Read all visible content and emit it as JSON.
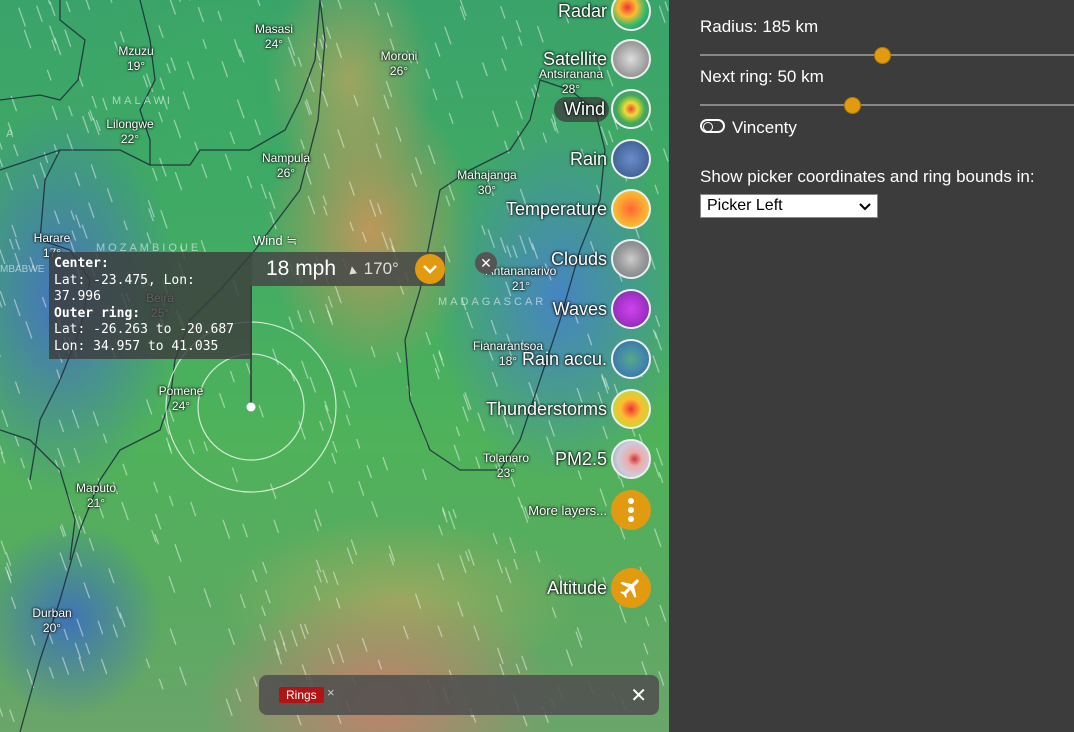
{
  "map": {
    "cities": [
      {
        "name": "Masasi",
        "temp": "24°"
      },
      {
        "name": "Mzuzu",
        "temp": "19°"
      },
      {
        "name": "Moroni",
        "temp": "26°"
      },
      {
        "name": "Antsiranana",
        "temp": "28°"
      },
      {
        "name": "Lilongwe",
        "temp": "22°"
      },
      {
        "name": "Nampula",
        "temp": "26°"
      },
      {
        "name": "Mahajanga",
        "temp": "30°"
      },
      {
        "name": "Harare",
        "temp": "17°"
      },
      {
        "name": "Antananarivo",
        "temp": "21°"
      },
      {
        "name": "Beira",
        "temp": "25°"
      },
      {
        "name": "Fianarantsoa",
        "temp": "18°"
      },
      {
        "name": "Pomene",
        "temp": "24°"
      },
      {
        "name": "Tolanaro",
        "temp": "23°"
      },
      {
        "name": "Maputo",
        "temp": "21°"
      },
      {
        "name": "Durban",
        "temp": "20°"
      }
    ],
    "countries": [
      "MALAWI",
      "MOZAMBIQUE",
      "MADAGASCAR",
      "A",
      "MBABWE"
    ],
    "wind_label": "Wind ≒",
    "picker": {
      "speed": "18 mph",
      "direction": "170°",
      "close": "✕",
      "expand_icon": "chevron-down-icon"
    },
    "info": {
      "center_title": "Center:",
      "center_value": "Lat: -23.475, Lon: 37.996",
      "outer_title": "Outer ring:",
      "outer_lat": "Lat: -26.263 to -20.687",
      "outer_lon": "Lon: 34.957 to 41.035"
    },
    "layers": [
      {
        "label": "Radar",
        "icon": "radar-icon"
      },
      {
        "label": "Satellite",
        "icon": "satellite-icon"
      },
      {
        "label": "Wind",
        "icon": "wind-icon",
        "active": true
      },
      {
        "label": "Rain",
        "icon": "rain-icon"
      },
      {
        "label": "Temperature",
        "icon": "temperature-icon"
      },
      {
        "label": "Clouds",
        "icon": "clouds-icon"
      },
      {
        "label": "Waves",
        "icon": "waves-icon"
      },
      {
        "label": "Rain accu.",
        "icon": "rain-accumulation-icon"
      },
      {
        "label": "Thunderstorms",
        "icon": "thunderstorms-icon"
      },
      {
        "label": "PM2.5",
        "icon": "pm25-icon"
      },
      {
        "label": "More layers...",
        "icon": "more-icon"
      },
      {
        "label": "Altitude",
        "icon": "airplane-icon"
      }
    ],
    "bottom_bar": {
      "tag": "Rings",
      "tag_close": "×",
      "close": "✕"
    }
  },
  "panel": {
    "radius_label": "Radius: 185 km",
    "radius_value": 0.48,
    "next_ring_label": "Next ring: 50 km",
    "next_ring_value": 0.4,
    "toggle_label": "Vincenty",
    "show_label": "Show picker coordinates and ring bounds in:",
    "select_value": "Picker Left"
  },
  "colors": {
    "accent": "#e29a10",
    "panel_bg": "#3c3c3c",
    "rings_tag": "#b01414"
  }
}
